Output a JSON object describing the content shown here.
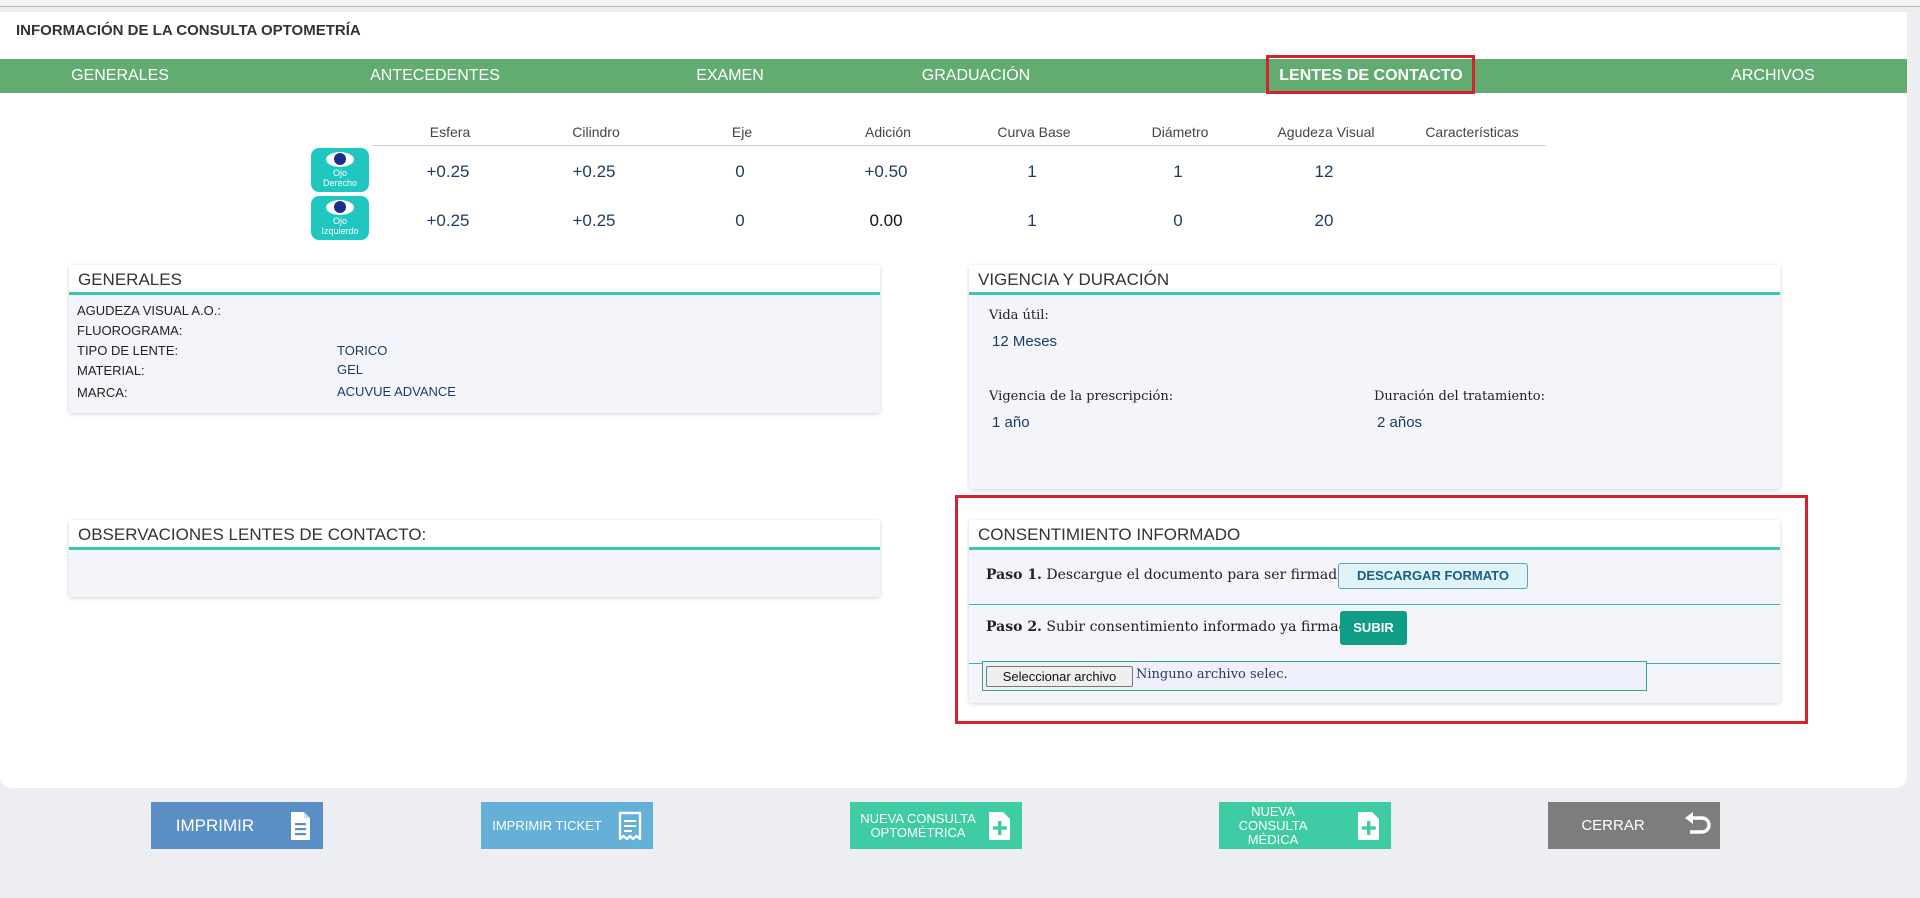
{
  "header": {
    "title": "INFORMACIÓN DE LA CONSULTA OPTOMETRÍA"
  },
  "tabs": [
    {
      "label": "GENERALES"
    },
    {
      "label": "ANTECEDENTES"
    },
    {
      "label": "EXAMEN"
    },
    {
      "label": "GRADUACIÓN"
    },
    {
      "label": "LENTES DE CONTACTO",
      "active": true
    },
    {
      "label": "ARCHIVOS"
    }
  ],
  "lens_table": {
    "headers": [
      "Esfera",
      "Cilindro",
      "Eje",
      "Adición",
      "Curva Base",
      "Diámetro",
      "Agudeza Visual",
      "Características"
    ],
    "rows": [
      {
        "eye_label": "Ojo Derecho",
        "eye_label_l1": "Ojo",
        "eye_label_l2": "Derecho",
        "values": [
          "+0.25",
          "+0.25",
          "0",
          "+0.50",
          "1",
          "1",
          "12",
          ""
        ]
      },
      {
        "eye_label": "Ojo Izquierdo",
        "eye_label_l1": "Ojo",
        "eye_label_l2": "Izquierdo",
        "values": [
          "+0.25",
          "+0.25",
          "0",
          "0.00",
          "1",
          "0",
          "20",
          ""
        ]
      }
    ]
  },
  "generales": {
    "title": "GENERALES",
    "fields": [
      {
        "label": "AGUDEZA VISUAL A.O.:",
        "value": ""
      },
      {
        "label": "FLUOROGRAMA:",
        "value": ""
      },
      {
        "label": "TIPO DE LENTE:",
        "value": "TORICO"
      },
      {
        "label": "MATERIAL:",
        "value": "GEL"
      },
      {
        "label": "MARCA:",
        "value": "ACUVUE ADVANCE"
      }
    ]
  },
  "vigencia": {
    "title": "VIGENCIA Y DURACIÓN",
    "vida_util_label": "Vida útil:",
    "vida_util_value": "12  Meses",
    "vigencia_label": "Vigencia de la prescripción:",
    "vigencia_value": "1 año",
    "duracion_label": "Duración del tratamiento:",
    "duracion_value": "2 años"
  },
  "observaciones": {
    "title": "OBSERVACIONES LENTES DE CONTACTO:"
  },
  "consentimiento": {
    "title": "CONSENTIMIENTO INFORMADO",
    "step1_bold": "Paso 1.",
    "step1_text": " Descargue el documento para ser firmado.",
    "download_label": "DESCARGAR FORMATO",
    "step2_bold": "Paso 2.",
    "step2_text": " Subir consentimiento informado ya firmado.",
    "upload_label": "SUBIR",
    "file_button": "Seleccionar archivo",
    "file_status": "Ninguno archivo selec."
  },
  "footer_buttons": {
    "imprimir": "IMPRIMIR",
    "imprimir_ticket": "IMPRIMIR TICKET",
    "nueva_optometrica": "NUEVA CONSULTA OPTOMÉTRICA",
    "nueva_medica": "NUEVA CONSULTA MÉDICA",
    "cerrar": "CERRAR"
  },
  "colors": {
    "tab_bar": "#62ac72",
    "highlight": "#d4232c",
    "accent": "#3cc7b1",
    "imprimir": "#5b8ec4",
    "imprimir_ticket": "#64b0d8",
    "nueva": "#3fcba4",
    "cerrar": "#7d7d7d"
  }
}
